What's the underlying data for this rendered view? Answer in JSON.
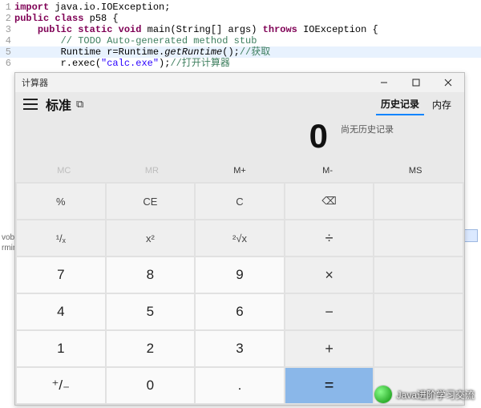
{
  "code": {
    "lines": [
      {
        "n": 1,
        "segs": [
          {
            "t": "import ",
            "c": "kw"
          },
          {
            "t": "java.io.IOException;",
            "c": "cls"
          }
        ]
      },
      {
        "n": 2,
        "segs": [
          {
            "t": "public class ",
            "c": "kw"
          },
          {
            "t": "p58 {",
            "c": "cls"
          }
        ]
      },
      {
        "n": 3,
        "segs": [
          {
            "t": "    ",
            "c": ""
          },
          {
            "t": "public static void ",
            "c": "kw"
          },
          {
            "t": "main(String[] args) ",
            "c": "cls"
          },
          {
            "t": "throws ",
            "c": "kw"
          },
          {
            "t": "IOException {",
            "c": "cls"
          }
        ]
      },
      {
        "n": 4,
        "segs": [
          {
            "t": "        ",
            "c": ""
          },
          {
            "t": "// TODO Auto-generated method stub",
            "c": "cmt"
          }
        ]
      },
      {
        "n": 5,
        "hl": true,
        "segs": [
          {
            "t": "        Runtime r=Runtime.",
            "c": "cls"
          },
          {
            "t": "getRuntime",
            "c": "mthd"
          },
          {
            "t": "();",
            "c": "cls"
          },
          {
            "t": "//获取",
            "c": "cmt"
          }
        ]
      },
      {
        "n": 6,
        "segs": [
          {
            "t": "        r.exec(",
            "c": "cls"
          },
          {
            "t": "\"calc.exe\"",
            "c": "str"
          },
          {
            "t": ");",
            "c": "cls"
          },
          {
            "t": "//打开计算器",
            "c": "cmt"
          }
        ]
      }
    ]
  },
  "left_markers": [
    "vobl.",
    "rmina"
  ],
  "calc": {
    "window_title": "计算器",
    "mode": "标准",
    "tabs": {
      "history": "历史记录",
      "memory": "内存"
    },
    "history_empty": "尚无历史记录",
    "display": "0",
    "memory_buttons": [
      {
        "id": "mc",
        "label": "MC",
        "disabled": true
      },
      {
        "id": "mr",
        "label": "MR",
        "disabled": true
      },
      {
        "id": "mplus",
        "label": "M+",
        "disabled": false
      },
      {
        "id": "mminus",
        "label": "M-",
        "disabled": false
      },
      {
        "id": "ms",
        "label": "MS",
        "disabled": false
      }
    ],
    "keys": [
      [
        {
          "id": "percent",
          "label": "%",
          "cls": "func"
        },
        {
          "id": "ce",
          "label": "CE",
          "cls": "func"
        },
        {
          "id": "c",
          "label": "C",
          "cls": "func"
        },
        {
          "id": "back",
          "label": "⌫",
          "cls": "func"
        },
        {
          "id": "blank1",
          "label": "",
          "cls": "func"
        }
      ],
      [
        {
          "id": "recip",
          "label": "¹/ₓ",
          "cls": "func"
        },
        {
          "id": "sq",
          "label": "x²",
          "cls": "func"
        },
        {
          "id": "sqrt",
          "label": "²√x",
          "cls": "func"
        },
        {
          "id": "div",
          "label": "÷",
          "cls": "op"
        },
        {
          "id": "blank2",
          "label": "",
          "cls": "func"
        }
      ],
      [
        {
          "id": "k7",
          "label": "7",
          "cls": "num"
        },
        {
          "id": "k8",
          "label": "8",
          "cls": "num"
        },
        {
          "id": "k9",
          "label": "9",
          "cls": "num"
        },
        {
          "id": "mul",
          "label": "×",
          "cls": "op"
        },
        {
          "id": "blank3",
          "label": "",
          "cls": "func"
        }
      ],
      [
        {
          "id": "k4",
          "label": "4",
          "cls": "num"
        },
        {
          "id": "k5",
          "label": "5",
          "cls": "num"
        },
        {
          "id": "k6",
          "label": "6",
          "cls": "num"
        },
        {
          "id": "sub",
          "label": "−",
          "cls": "op"
        },
        {
          "id": "blank4",
          "label": "",
          "cls": "func"
        }
      ],
      [
        {
          "id": "k1",
          "label": "1",
          "cls": "num"
        },
        {
          "id": "k2",
          "label": "2",
          "cls": "num"
        },
        {
          "id": "k3",
          "label": "3",
          "cls": "num"
        },
        {
          "id": "add",
          "label": "+",
          "cls": "op"
        },
        {
          "id": "blank5",
          "label": "",
          "cls": "func"
        }
      ],
      [
        {
          "id": "sign",
          "label": "⁺/₋",
          "cls": "num"
        },
        {
          "id": "k0",
          "label": "0",
          "cls": "num"
        },
        {
          "id": "dot",
          "label": ".",
          "cls": "num"
        },
        {
          "id": "eq",
          "label": "=",
          "cls": "equals"
        },
        {
          "id": "blank6",
          "label": "",
          "cls": "func"
        }
      ]
    ]
  },
  "watermark": "Java进阶学习交流"
}
